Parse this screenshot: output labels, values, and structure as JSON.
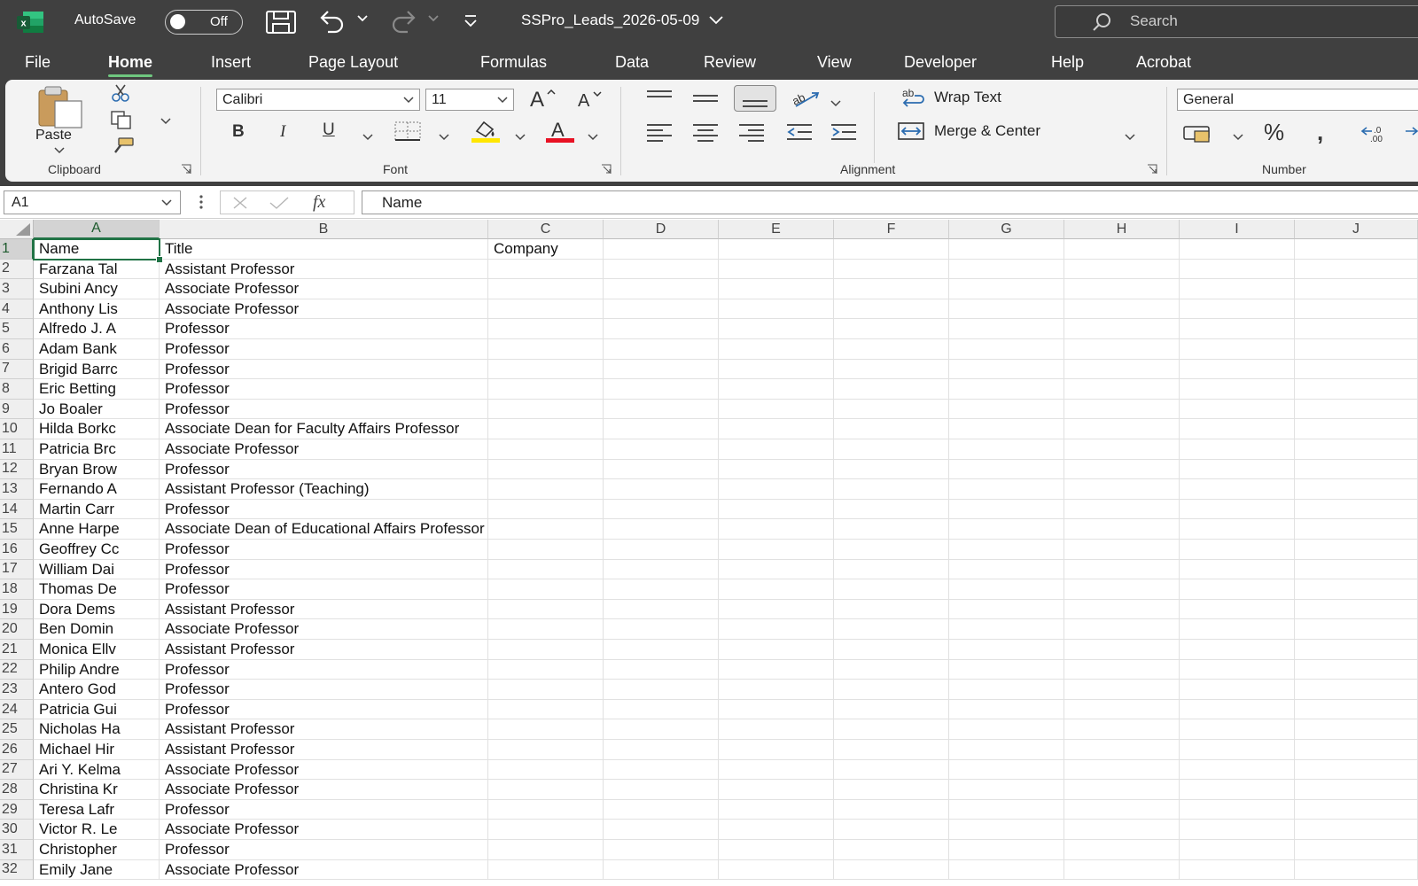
{
  "titlebar": {
    "autosave_label": "AutoSave",
    "autosave_state": "Off",
    "doc_title": "SSPro_Leads_2026-05-09",
    "search_placeholder": "Search",
    "brand_color": "#217346"
  },
  "menu": {
    "tabs": [
      "File",
      "Home",
      "Insert",
      "Page Layout",
      "Formulas",
      "Data",
      "Review",
      "View",
      "Developer",
      "Help",
      "Acrobat"
    ],
    "active": "Home"
  },
  "ribbon": {
    "clipboard": {
      "paste": "Paste",
      "label": "Clipboard"
    },
    "font": {
      "name": "Calibri",
      "size": "11",
      "label": "Font",
      "highlight_color": "#ffe600",
      "font_color": "#e81123"
    },
    "alignment": {
      "wrap_text": "Wrap Text",
      "merge_center": "Merge & Center",
      "label": "Alignment"
    },
    "number": {
      "format": "General",
      "label": "Number"
    }
  },
  "formula_bar": {
    "name_box": "A1",
    "fx": "fx",
    "content": "Name"
  },
  "sheet": {
    "columns": [
      "A",
      "B",
      "C",
      "D",
      "E",
      "F",
      "G",
      "H",
      "I",
      "J"
    ],
    "selected_cell": "A1",
    "rows": [
      {
        "num": "1",
        "a": "Name",
        "b": "Title",
        "c": "Company"
      },
      {
        "num": "2",
        "a": "Farzana Tal",
        "b": "Assistant Professor"
      },
      {
        "num": "3",
        "a": "Subini Ancy",
        "b": "Associate Professor"
      },
      {
        "num": "4",
        "a": "Anthony Lis",
        "b": "Associate Professor"
      },
      {
        "num": "5",
        "a": "Alfredo J. A",
        "b": "Professor"
      },
      {
        "num": "6",
        "a": "Adam Bank",
        "b": "Professor"
      },
      {
        "num": "7",
        "a": "Brigid Barrc",
        "b": "Professor"
      },
      {
        "num": "8",
        "a": "Eric Betting",
        "b": "Professor"
      },
      {
        "num": "9",
        "a": "Jo Boaler",
        "b": "Professor"
      },
      {
        "num": "10",
        "a": "Hilda Borkc",
        "b": "Associate Dean for Faculty Affairs Professor"
      },
      {
        "num": "11",
        "a": "Patricia Brc",
        "b": "Associate Professor"
      },
      {
        "num": "12",
        "a": "Bryan Brow",
        "b": "Professor"
      },
      {
        "num": "13",
        "a": "Fernando A",
        "b": "Assistant Professor (Teaching)"
      },
      {
        "num": "14",
        "a": "Martin Carr",
        "b": "Professor"
      },
      {
        "num": "15",
        "a": "Anne Harpe",
        "b": "Associate Dean of Educational Affairs Professor"
      },
      {
        "num": "16",
        "a": "Geoffrey Cc",
        "b": "Professor"
      },
      {
        "num": "17",
        "a": "William Dai",
        "b": "Professor"
      },
      {
        "num": "18",
        "a": "Thomas De",
        "b": "Professor"
      },
      {
        "num": "19",
        "a": "Dora Dems",
        "b": "Assistant Professor"
      },
      {
        "num": "20",
        "a": "Ben Domin",
        "b": "Associate Professor"
      },
      {
        "num": "21",
        "a": "Monica Ellv",
        "b": "Assistant Professor"
      },
      {
        "num": "22",
        "a": "Philip Andre",
        "b": "Professor"
      },
      {
        "num": "23",
        "a": "Antero God",
        "b": "Professor"
      },
      {
        "num": "24",
        "a": "Patricia Gui",
        "b": "Professor"
      },
      {
        "num": "25",
        "a": "Nicholas Ha",
        "b": "Assistant Professor"
      },
      {
        "num": "26",
        "a": "Michael Hir",
        "b": "Assistant Professor"
      },
      {
        "num": "27",
        "a": "Ari Y. Kelma",
        "b": "Associate Professor"
      },
      {
        "num": "28",
        "a": "Christina Kr",
        "b": "Associate Professor"
      },
      {
        "num": "29",
        "a": "Teresa Lafr",
        "b": "Professor"
      },
      {
        "num": "30",
        "a": "Victor R. Le",
        "b": "Associate Professor"
      },
      {
        "num": "31",
        "a": "Christopher",
        "b": "Professor"
      },
      {
        "num": "32",
        "a": "Emily Jane",
        "b": "Associate Professor"
      }
    ]
  }
}
